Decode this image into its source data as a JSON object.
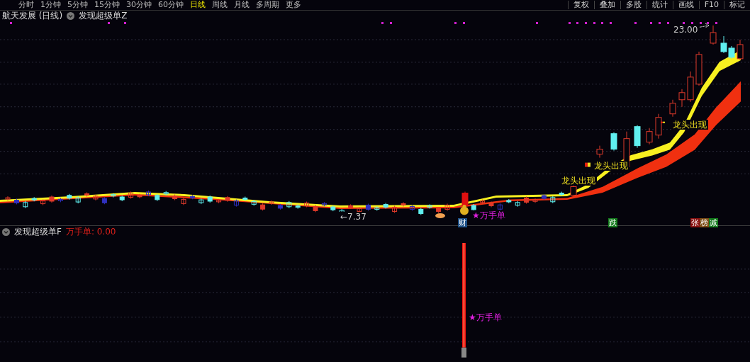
{
  "toolbar": {
    "periods": [
      {
        "label": "分时",
        "selected": false
      },
      {
        "label": "1分钟",
        "selected": false
      },
      {
        "label": "5分钟",
        "selected": false
      },
      {
        "label": "15分钟",
        "selected": false
      },
      {
        "label": "30分钟",
        "selected": false
      },
      {
        "label": "60分钟",
        "selected": false
      },
      {
        "label": "日线",
        "selected": true
      },
      {
        "label": "周线",
        "selected": false
      },
      {
        "label": "月线",
        "selected": false
      },
      {
        "label": "多周期",
        "selected": false
      },
      {
        "label": "更多",
        "selected": false
      }
    ],
    "tools": [
      "复权",
      "叠加",
      "多股",
      "统计",
      "画线",
      "F10",
      "标记"
    ]
  },
  "main_pane": {
    "stock_title": "航天发展 (日线)",
    "indicator": "发现超级单Z",
    "price_labels": [
      {
        "text": "23.00"
      },
      {
        "text": "←7.37"
      }
    ],
    "signals": [
      {
        "text": "龙头出现"
      },
      {
        "text": "龙头出现"
      },
      {
        "text": "龙头出现"
      },
      {
        "text": "★万手单"
      }
    ],
    "markers": [
      {
        "text": "财",
        "color": "#1c4f86"
      },
      {
        "text": "跌",
        "color": "#137a1c"
      },
      {
        "text": "张",
        "color": "#8a1010"
      },
      {
        "text": "榜",
        "color": "#7a4a12"
      },
      {
        "text": "减",
        "color": "#137a1c"
      }
    ]
  },
  "lower_pane": {
    "indicator": "发现超级单F",
    "reading": "万手单: 0.00",
    "bar_label": "★万手单"
  }
}
